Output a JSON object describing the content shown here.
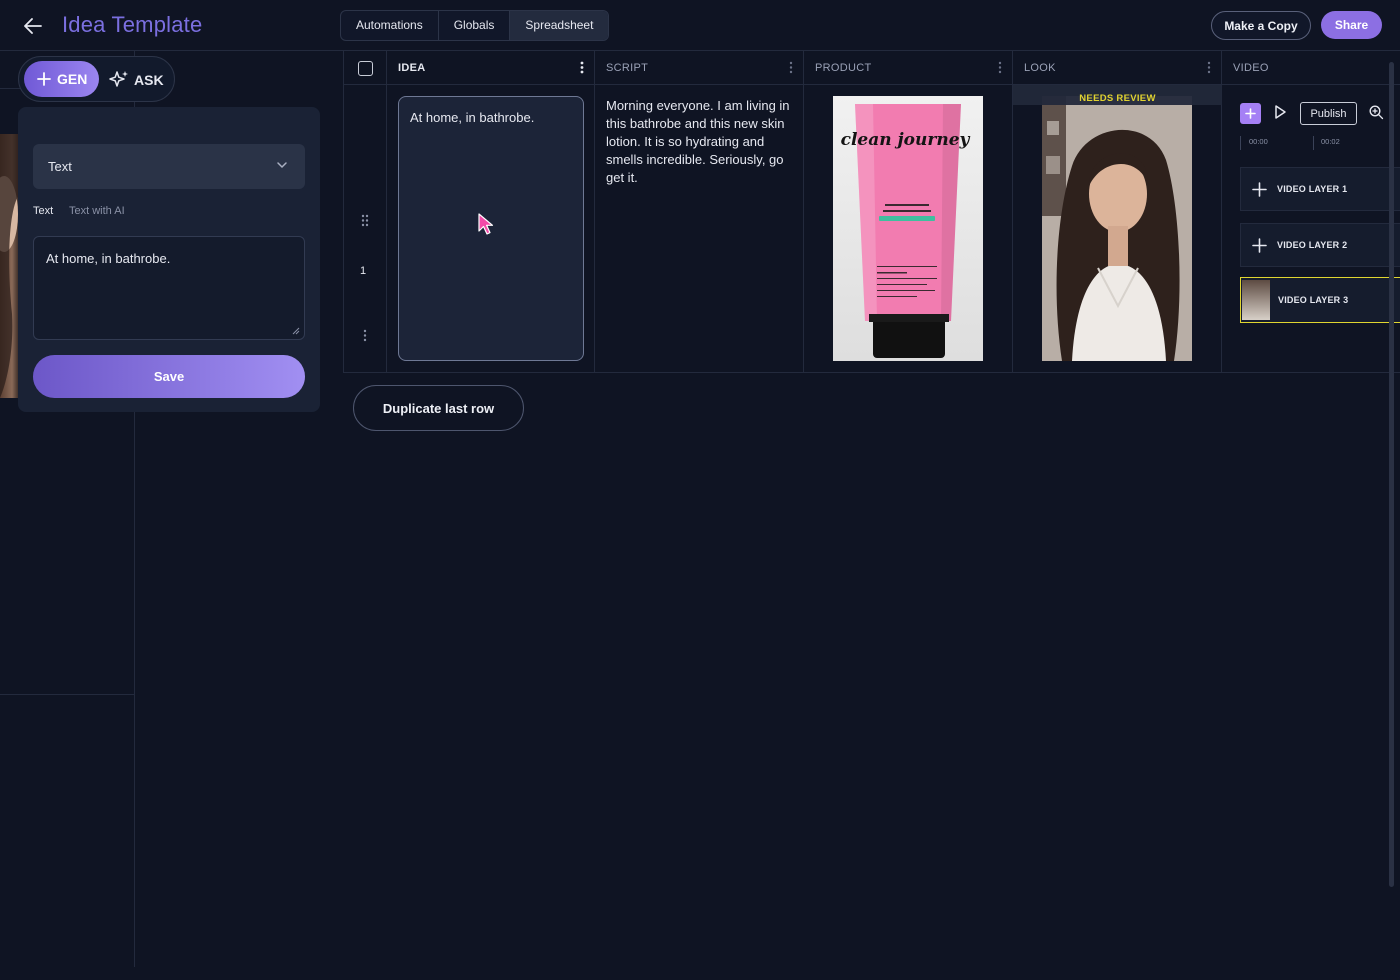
{
  "header": {
    "title": "Idea Template",
    "tabs": [
      "Automations",
      "Globals",
      "Spreadsheet"
    ],
    "active_tab": "Spreadsheet",
    "make_copy_label": "Make a Copy",
    "share_label": "Share"
  },
  "panel": {
    "gen_label": "GEN",
    "ask_label": "ASK",
    "type_select_value": "Text",
    "mode_tabs": [
      "Text",
      "Text with AI"
    ],
    "value": "At home, in bathrobe.",
    "save_label": "Save"
  },
  "grid": {
    "columns": [
      "IDEA",
      "SCRIPT",
      "PRODUCT",
      "LOOK",
      "VIDEO"
    ],
    "rows": [
      {
        "number": "1",
        "idea": "At home, in bathrobe.",
        "script": "Morning everyone. I am living in this bathrobe and this new skin lotion. It is so hydrating and smells incredible. Seriously, go get it.",
        "product_brand": "clean journey",
        "look_status": "NEEDS REVIEW",
        "video": {
          "publish_label": "Publish",
          "ruler": [
            "00:00",
            "00:02"
          ],
          "layers": [
            "VIDEO LAYER 1",
            "VIDEO LAYER 2",
            "VIDEO LAYER 3"
          ]
        }
      }
    ],
    "duplicate_label": "Duplicate last row"
  },
  "colors": {
    "background": "#0f1423",
    "accent": "#8c6fe3",
    "review": "#e0d230"
  }
}
